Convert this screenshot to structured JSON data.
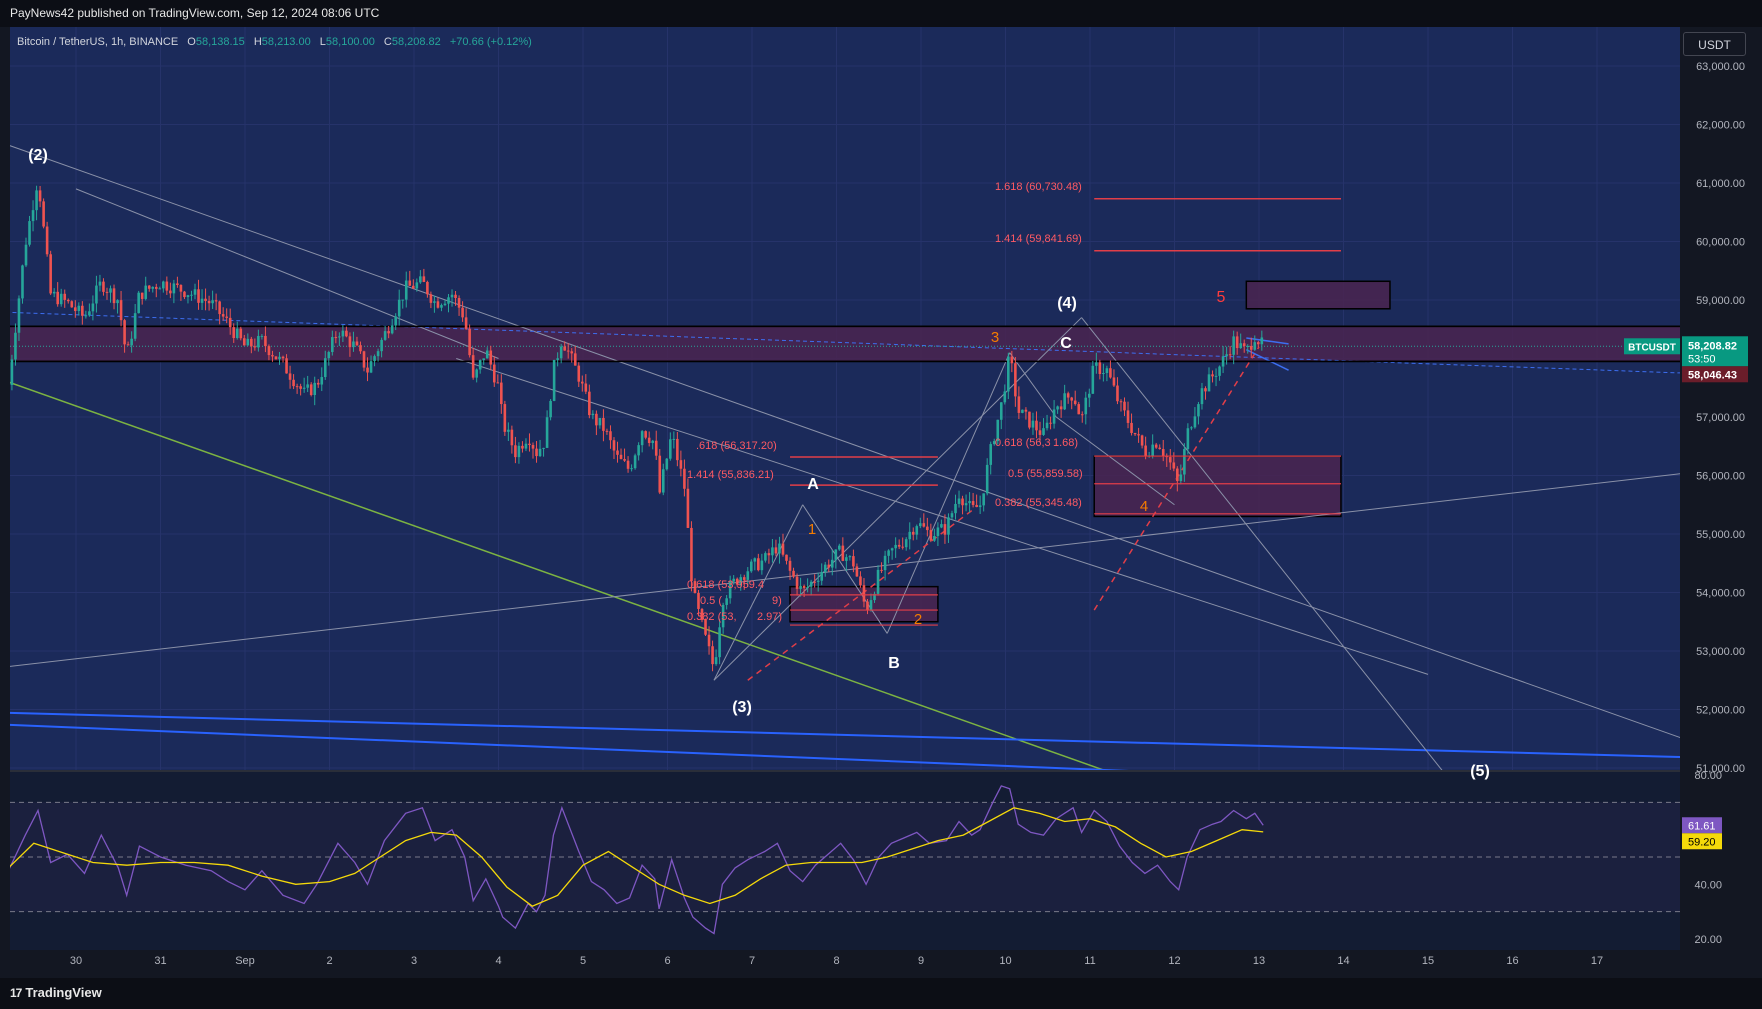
{
  "header": {
    "publisher_line": "PayNews42 published on TradingView.com, Sep 12, 2024 08:06 UTC"
  },
  "symbol": {
    "name": "Bitcoin / TetherUS, 1h, BINANCE",
    "o_label": "O",
    "o_value": "58,138.15",
    "h_label": "H",
    "h_value": "58,213.00",
    "l_label": "L",
    "l_value": "58,100.00",
    "c_label": "C",
    "c_value": "58,208.82",
    "change": "+70.66 (+0.12%)"
  },
  "currency_button": "USDT",
  "footer": {
    "brand": "TradingView"
  },
  "colors": {
    "background": "#1b2a5a",
    "zone_fill": "#4a2550",
    "candle_up": "#26a69a",
    "candle_down": "#ef5350",
    "fib_red": "#e23e48",
    "rsi_line": "#7e57c2",
    "rsi_ma": "#f5d90a",
    "trend_green": "#7cb342",
    "trend_blue": "#2962ff"
  },
  "chart_data": {
    "type": "candlestick",
    "price_axis": {
      "range": [
        50800,
        63300
      ],
      "ticks": [
        "63,000.00",
        "62,000.00",
        "61,000.00",
        "60,000.00",
        "59,000.00",
        "58,000.00",
        "57,000.00",
        "56,000.00",
        "55,000.00",
        "54,000.00",
        "53,000.00",
        "52,000.00",
        "51,000.00"
      ],
      "tick_values": [
        63000,
        62000,
        61000,
        60000,
        59000,
        58000,
        57000,
        56000,
        55000,
        54000,
        53000,
        52000,
        51000
      ]
    },
    "time_axis": {
      "labels": [
        "30",
        "31",
        "Sep",
        "2",
        "3",
        "4",
        "5",
        "6",
        "7",
        "8",
        "9",
        "10",
        "11",
        "12",
        "13",
        "14",
        "15",
        "16",
        "17"
      ],
      "day_offsets": [
        0,
        1,
        2,
        3,
        4,
        5,
        6,
        7,
        8,
        9,
        10,
        11,
        12,
        13,
        14,
        15,
        16,
        17,
        18
      ]
    },
    "last_price": {
      "symbol": "BTCUSDT",
      "price": "58,208.82",
      "countdown": "53:50",
      "value": 58208.82
    },
    "level_marker": {
      "price": "58,046.43",
      "value": 58046.43
    },
    "price_path": [
      [
        -0.8,
        57550
      ],
      [
        -0.6,
        59950
      ],
      [
        -0.45,
        61100
      ],
      [
        -0.3,
        59100
      ],
      [
        -0.1,
        58950
      ],
      [
        0.1,
        58700
      ],
      [
        0.3,
        59300
      ],
      [
        0.5,
        59000
      ],
      [
        0.6,
        58000
      ],
      [
        0.75,
        59100
      ],
      [
        1.0,
        59300
      ],
      [
        1.3,
        59150
      ],
      [
        1.6,
        58950
      ],
      [
        1.8,
        58600
      ],
      [
        2.0,
        58200
      ],
      [
        2.2,
        58300
      ],
      [
        2.45,
        57900
      ],
      [
        2.7,
        57400
      ],
      [
        2.85,
        57550
      ],
      [
        3.1,
        58500
      ],
      [
        3.3,
        58200
      ],
      [
        3.45,
        57800
      ],
      [
        3.65,
        58400
      ],
      [
        3.9,
        59200
      ],
      [
        4.1,
        59300
      ],
      [
        4.25,
        58950
      ],
      [
        4.45,
        59100
      ],
      [
        4.6,
        58700
      ],
      [
        4.7,
        57600
      ],
      [
        4.85,
        58150
      ],
      [
        5.0,
        57500
      ],
      [
        5.05,
        56900
      ],
      [
        5.2,
        56400
      ],
      [
        5.35,
        56700
      ],
      [
        5.45,
        56400
      ],
      [
        5.55,
        56600
      ],
      [
        5.65,
        57800
      ],
      [
        5.75,
        58350
      ],
      [
        5.95,
        57700
      ],
      [
        6.1,
        57000
      ],
      [
        6.25,
        56800
      ],
      [
        6.4,
        56300
      ],
      [
        6.55,
        56100
      ],
      [
        6.7,
        56800
      ],
      [
        6.85,
        56550
      ],
      [
        6.9,
        55650
      ],
      [
        7.05,
        56700
      ],
      [
        7.2,
        55800
      ],
      [
        7.3,
        54000
      ],
      [
        7.45,
        53200
      ],
      [
        7.55,
        52700
      ],
      [
        7.65,
        53900
      ],
      [
        7.8,
        54200
      ],
      [
        7.95,
        54400
      ],
      [
        8.15,
        54550
      ],
      [
        8.3,
        54800
      ],
      [
        8.45,
        54350
      ],
      [
        8.6,
        54000
      ],
      [
        8.75,
        54250
      ],
      [
        8.9,
        54500
      ],
      [
        9.05,
        54700
      ],
      [
        9.2,
        54500
      ],
      [
        9.35,
        53700
      ],
      [
        9.5,
        54300
      ],
      [
        9.65,
        54700
      ],
      [
        9.8,
        54900
      ],
      [
        9.95,
        55200
      ],
      [
        10.1,
        55000
      ],
      [
        10.3,
        55100
      ],
      [
        10.45,
        55700
      ],
      [
        10.6,
        55400
      ],
      [
        10.7,
        55500
      ],
      [
        10.85,
        56600
      ],
      [
        10.95,
        57200
      ],
      [
        11.05,
        58050
      ],
      [
        11.15,
        57100
      ],
      [
        11.3,
        56900
      ],
      [
        11.45,
        56700
      ],
      [
        11.6,
        57200
      ],
      [
        11.8,
        57400
      ],
      [
        11.9,
        56950
      ],
      [
        12.05,
        57850
      ],
      [
        12.2,
        57800
      ],
      [
        12.35,
        57200
      ],
      [
        12.5,
        56800
      ],
      [
        12.65,
        56400
      ],
      [
        12.8,
        56600
      ],
      [
        12.95,
        56200
      ],
      [
        13.05,
        55800
      ],
      [
        13.15,
        56700
      ],
      [
        13.3,
        57400
      ],
      [
        13.45,
        57700
      ],
      [
        13.55,
        57900
      ],
      [
        13.7,
        58300
      ],
      [
        13.85,
        58100
      ],
      [
        13.95,
        58400
      ],
      [
        14.05,
        58200
      ]
    ],
    "rsi": {
      "range": [
        20,
        80
      ],
      "ticks": [
        "80.00",
        "40.00",
        "20.00"
      ],
      "tick_values": [
        80,
        40,
        20
      ],
      "bands": [
        70,
        50,
        30
      ],
      "current_rsi": "61.61",
      "current_ma": "59.20",
      "rsi_value": 61.61,
      "ma_value": 59.2,
      "points": [
        [
          -0.8,
          45
        ],
        [
          -0.6,
          58
        ],
        [
          -0.45,
          67
        ],
        [
          -0.3,
          48
        ],
        [
          -0.1,
          51
        ],
        [
          0.1,
          44
        ],
        [
          0.3,
          58
        ],
        [
          0.5,
          46
        ],
        [
          0.6,
          36
        ],
        [
          0.75,
          54
        ],
        [
          1.0,
          50
        ],
        [
          1.3,
          47
        ],
        [
          1.6,
          45
        ],
        [
          1.8,
          41
        ],
        [
          2.0,
          38
        ],
        [
          2.2,
          45
        ],
        [
          2.45,
          36
        ],
        [
          2.7,
          33
        ],
        [
          2.85,
          40
        ],
        [
          3.1,
          55
        ],
        [
          3.3,
          48
        ],
        [
          3.45,
          40
        ],
        [
          3.65,
          56
        ],
        [
          3.9,
          66
        ],
        [
          4.1,
          68
        ],
        [
          4.25,
          56
        ],
        [
          4.45,
          60
        ],
        [
          4.6,
          50
        ],
        [
          4.7,
          34
        ],
        [
          4.85,
          42
        ],
        [
          5.0,
          32
        ],
        [
          5.05,
          28
        ],
        [
          5.2,
          24
        ],
        [
          5.35,
          33
        ],
        [
          5.45,
          30
        ],
        [
          5.55,
          36
        ],
        [
          5.65,
          58
        ],
        [
          5.75,
          68
        ],
        [
          5.95,
          52
        ],
        [
          6.1,
          41
        ],
        [
          6.25,
          38
        ],
        [
          6.4,
          33
        ],
        [
          6.55,
          35
        ],
        [
          6.7,
          47
        ],
        [
          6.85,
          42
        ],
        [
          6.9,
          31
        ],
        [
          7.05,
          49
        ],
        [
          7.2,
          35
        ],
        [
          7.3,
          28
        ],
        [
          7.45,
          24
        ],
        [
          7.55,
          22
        ],
        [
          7.65,
          40
        ],
        [
          7.8,
          46
        ],
        [
          7.95,
          49
        ],
        [
          8.15,
          52
        ],
        [
          8.3,
          55
        ],
        [
          8.45,
          45
        ],
        [
          8.6,
          41
        ],
        [
          8.75,
          47
        ],
        [
          8.9,
          51
        ],
        [
          9.05,
          55
        ],
        [
          9.2,
          49
        ],
        [
          9.35,
          40
        ],
        [
          9.5,
          50
        ],
        [
          9.65,
          55
        ],
        [
          9.8,
          57
        ],
        [
          9.95,
          59
        ],
        [
          10.1,
          55
        ],
        [
          10.3,
          56
        ],
        [
          10.45,
          63
        ],
        [
          10.6,
          58
        ],
        [
          10.7,
          60
        ],
        [
          10.85,
          70
        ],
        [
          10.95,
          76
        ],
        [
          11.05,
          75
        ],
        [
          11.15,
          62
        ],
        [
          11.3,
          59
        ],
        [
          11.45,
          58
        ],
        [
          11.6,
          64
        ],
        [
          11.8,
          68
        ],
        [
          11.9,
          59
        ],
        [
          12.05,
          67
        ],
        [
          12.2,
          63
        ],
        [
          12.35,
          54
        ],
        [
          12.5,
          48
        ],
        [
          12.65,
          44
        ],
        [
          12.8,
          47
        ],
        [
          12.95,
          41
        ],
        [
          13.05,
          38
        ],
        [
          13.15,
          50
        ],
        [
          13.3,
          60
        ],
        [
          13.45,
          62
        ],
        [
          13.55,
          63
        ],
        [
          13.7,
          67
        ],
        [
          13.85,
          64
        ],
        [
          13.95,
          66
        ],
        [
          14.05,
          61.61
        ]
      ],
      "ma_points": [
        [
          -0.8,
          46
        ],
        [
          -0.5,
          55
        ],
        [
          -0.2,
          52
        ],
        [
          0.2,
          48
        ],
        [
          0.6,
          47
        ],
        [
          1.0,
          48
        ],
        [
          1.4,
          48
        ],
        [
          1.8,
          47
        ],
        [
          2.2,
          43
        ],
        [
          2.6,
          40
        ],
        [
          3.0,
          41
        ],
        [
          3.3,
          44
        ],
        [
          3.6,
          50
        ],
        [
          3.9,
          56
        ],
        [
          4.2,
          59
        ],
        [
          4.5,
          58
        ],
        [
          4.8,
          50
        ],
        [
          5.1,
          39
        ],
        [
          5.4,
          32
        ],
        [
          5.7,
          36
        ],
        [
          6.0,
          47
        ],
        [
          6.3,
          52
        ],
        [
          6.6,
          46
        ],
        [
          6.9,
          40
        ],
        [
          7.2,
          36
        ],
        [
          7.5,
          33
        ],
        [
          7.8,
          36
        ],
        [
          8.1,
          42
        ],
        [
          8.4,
          47
        ],
        [
          8.7,
          48
        ],
        [
          9.0,
          48
        ],
        [
          9.3,
          48
        ],
        [
          9.6,
          50
        ],
        [
          9.9,
          53
        ],
        [
          10.2,
          56
        ],
        [
          10.5,
          58
        ],
        [
          10.8,
          63
        ],
        [
          11.1,
          68
        ],
        [
          11.4,
          66
        ],
        [
          11.7,
          63
        ],
        [
          12.0,
          64
        ],
        [
          12.3,
          61
        ],
        [
          12.6,
          55
        ],
        [
          12.9,
          50
        ],
        [
          13.2,
          52
        ],
        [
          13.5,
          56
        ],
        [
          13.8,
          60
        ],
        [
          14.05,
          59.2
        ]
      ]
    },
    "zones": [
      {
        "from_day": -1,
        "to_day": 20,
        "low": 57950,
        "high": 58550
      },
      {
        "from_day": 8.45,
        "to_day": 10.2,
        "low": 53500,
        "high": 54100
      },
      {
        "from_day": 12.05,
        "to_day": 14.97,
        "low": 55300,
        "high": 56330
      },
      {
        "from_day": 13.85,
        "to_day": 15.55,
        "low": 58850,
        "high": 59320
      }
    ],
    "fib_levels": [
      {
        "label": "1.618 (60,730.48)",
        "value": 60730.48,
        "from_day": 12.05,
        "to_day": 14.97
      },
      {
        "label": "1.414 (59,841.69)",
        "value": 59841.69,
        "from_day": 12.05,
        "to_day": 14.97
      },
      {
        "label": "0.618 (56,3?1.68)",
        "display": "0.618 (56,3",
        "suffix": "1.68)",
        "value": 56331.68
      },
      {
        "label": "0.5 (55,859.58)",
        "value": 55859.58
      },
      {
        "label": "0.382 (55,345.48)",
        "value": 55345.48
      },
      {
        "label": "1.618 (56,317.20)",
        "display": "1.618 (56,317.20)",
        "value": 56317.2,
        "from_day": 8.45,
        "to_day": 10.2
      },
      {
        "label": "1.414 (55,836.21)",
        "display": "1.414 (55,836.21)",
        "value": 55836.21,
        "from_day": 8.45,
        "to_day": 10.2
      },
      {
        "label": "0.618 (53,959.4",
        "value": 53959.4
      },
      {
        "label": "0.5 (53,6??.?9)",
        "value": 53700
      },
      {
        "label": "0.382 (53,442.97)",
        "value": 53442.97
      }
    ],
    "fib_text": {
      "f1618a": "1.618 (60,730.48)",
      "f1414a": "1.414 (59,841.69)",
      "f0618a": "0.618 (56,3",
      "f0618a_tail": "1.68)",
      "f05a": "0.5 (55,859.58)",
      "f0382a": "0.382 (55,345.48)",
      "f1618b": ".618 (56,317.20)",
      "f1414b": "1.414 (55,836.21)",
      "f0618b": "0.618 (53,959.4",
      "f05b": "0.5 (",
      "f05b_tail": "9)",
      "f0382b": "0.382 (53,",
      "f0382b_tail": "2.97)"
    },
    "wave_labels": {
      "w2": "(2)",
      "w3": "(3)",
      "w4": "(4)",
      "w5": "(5)",
      "A": "A",
      "B": "B",
      "C": "C",
      "o1": "1",
      "o2": "2",
      "o3": "3",
      "o4": "4",
      "o5": "5"
    }
  }
}
